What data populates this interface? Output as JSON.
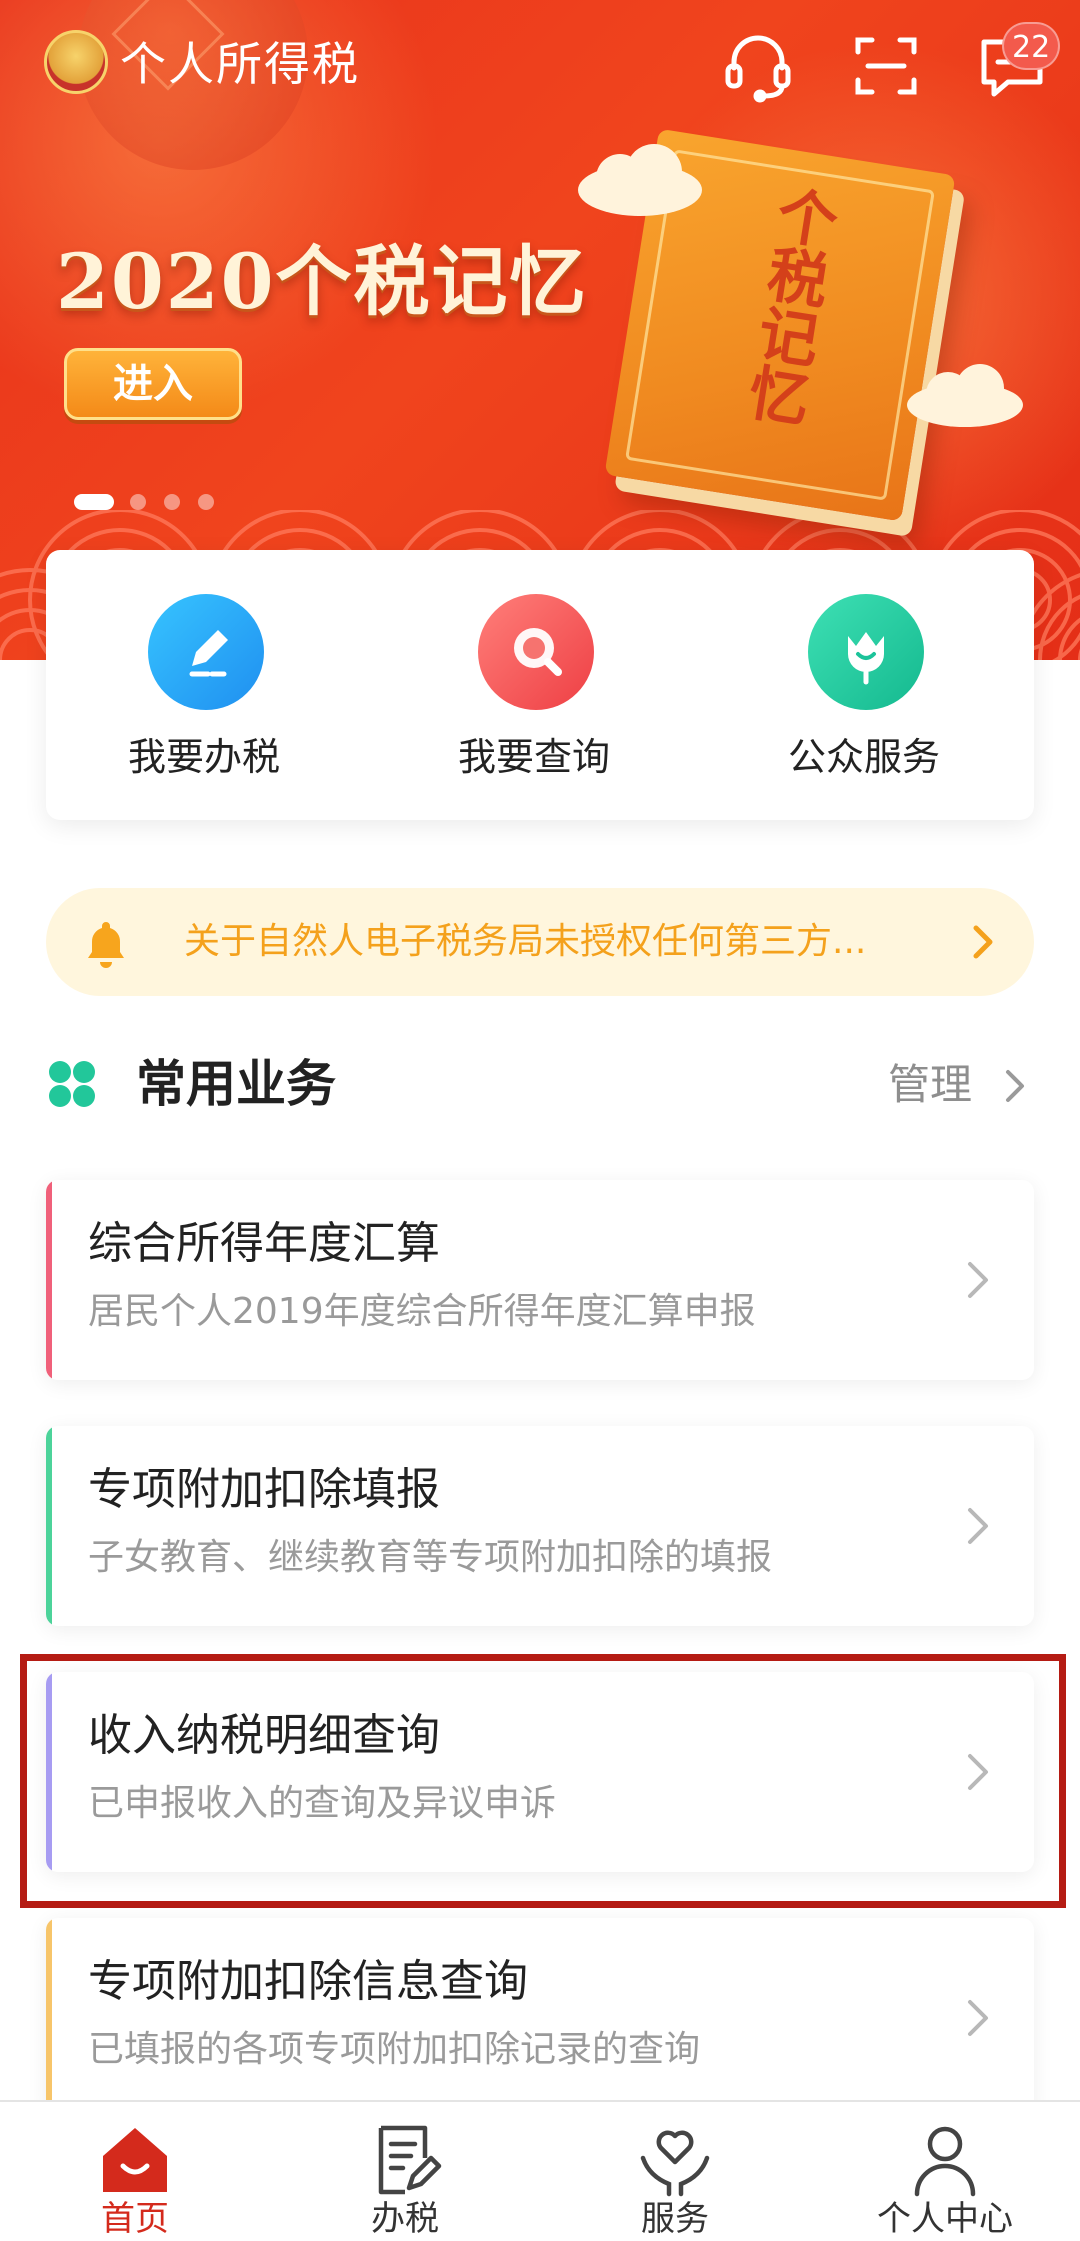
{
  "app": {
    "title": "个人所得税"
  },
  "header": {
    "notification_count": "22"
  },
  "banner": {
    "headline": "2020个税记忆",
    "enter_label": "进入",
    "book_text": "个税记忆",
    "slides": 4,
    "active_slide": 1
  },
  "quick_actions": [
    {
      "label": "我要办税",
      "icon": "edit-icon",
      "color": "#2aa8f2"
    },
    {
      "label": "我要查询",
      "icon": "search-icon",
      "color": "#f45a55"
    },
    {
      "label": "公众服务",
      "icon": "tulip-icon",
      "color": "#21c8a0"
    }
  ],
  "notice": {
    "text": "关于自然人电子税务局未授权任何第三方..."
  },
  "section": {
    "title": "常用业务",
    "manage_label": "管理"
  },
  "cards": [
    {
      "title": "综合所得年度汇算",
      "subtitle": "居民个人2019年度综合所得年度汇算申报",
      "accent": "#f0607a"
    },
    {
      "title": "专项附加扣除填报",
      "subtitle": "子女教育、继续教育等专项附加扣除的填报",
      "accent": "#4cd39a"
    },
    {
      "title": "收入纳税明细查询",
      "subtitle": "已申报收入的查询及异议申诉",
      "accent": "#a79cf2"
    },
    {
      "title": "专项附加扣除信息查询",
      "subtitle": "已填报的各项专项附加扣除记录的查询",
      "accent": "#f7c56a"
    }
  ],
  "bottom_nav": [
    {
      "label": "首页",
      "icon": "home-icon",
      "active": true
    },
    {
      "label": "办税",
      "icon": "document-edit-icon",
      "active": false
    },
    {
      "label": "服务",
      "icon": "heart-hands-icon",
      "active": false
    },
    {
      "label": "个人中心",
      "icon": "person-icon",
      "active": false
    }
  ],
  "colors": {
    "brand_red": "#e8321c",
    "active_nav": "#d42a1c",
    "notice_text": "#f4a11c",
    "notice_bg": "#fff6dd",
    "highlight_border": "#b51c14"
  }
}
